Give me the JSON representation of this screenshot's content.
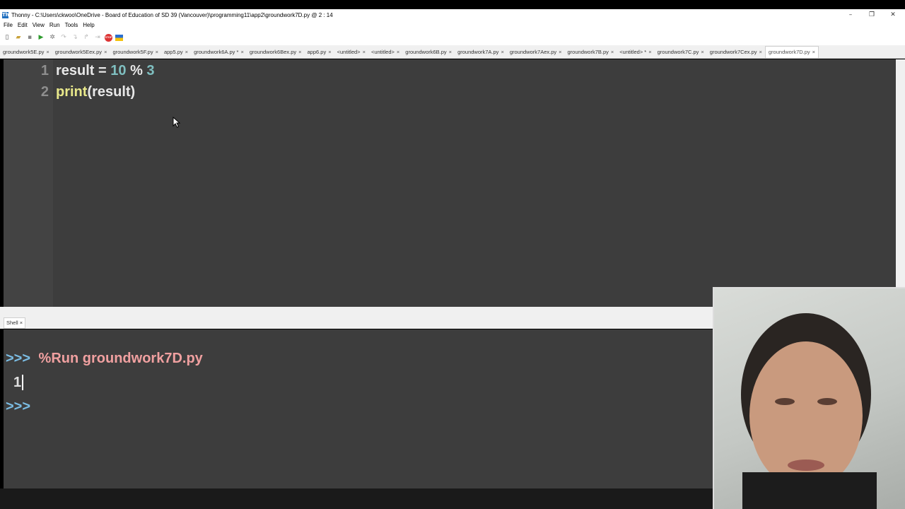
{
  "window": {
    "title": "Thonny  -  C:\\Users\\ckwoo\\OneDrive - Board of Education of SD 39 (Vancouver)\\programming11\\app2\\groundwork7D.py  @  2 : 14",
    "logo_text": "Th",
    "minimize": "–",
    "restore": "❐",
    "close": "✕"
  },
  "menu": [
    "File",
    "Edit",
    "View",
    "Run",
    "Tools",
    "Help"
  ],
  "toolbar": {
    "new": "▯",
    "open": "▰",
    "save": "▪",
    "run": "▶",
    "debug": "✲",
    "step_over": "↷",
    "step_into": "↴",
    "step_out": "↱",
    "resume": "⇥",
    "stop": "STOP",
    "flag": "■"
  },
  "tabs": [
    "groundwork5E.py",
    "groundwork5Eex.py",
    "groundwork5F.py",
    "app5.py",
    "groundwork6A.py *",
    "groundwork6Bex.py",
    "app6.py",
    "<untitled>",
    "<untitled>",
    "groundwork6B.py",
    "groundwork7A.py",
    "groundwork7Aex.py",
    "groundwork7B.py",
    "<untitled> *",
    "groundwork7C.py",
    "groundwork7Cex.py",
    "groundwork7D.py"
  ],
  "tab_close": "×",
  "editor": {
    "line_numbers": [
      "1",
      "2"
    ],
    "line1": {
      "a": "result = ",
      "b": "10",
      "c": " % ",
      "d": "3"
    },
    "line2": {
      "a": "print",
      "b": "(result)"
    }
  },
  "shell": {
    "tab_label": "Shell ×",
    "prompt": ">>>",
    "command": " %Run groundwork7D.py",
    "output": "1"
  },
  "colors": {
    "editor_bg": "#3d3d3d",
    "prompt": "#7bbde4",
    "command": "#f0a0a0",
    "number": "#7fbfc0"
  }
}
